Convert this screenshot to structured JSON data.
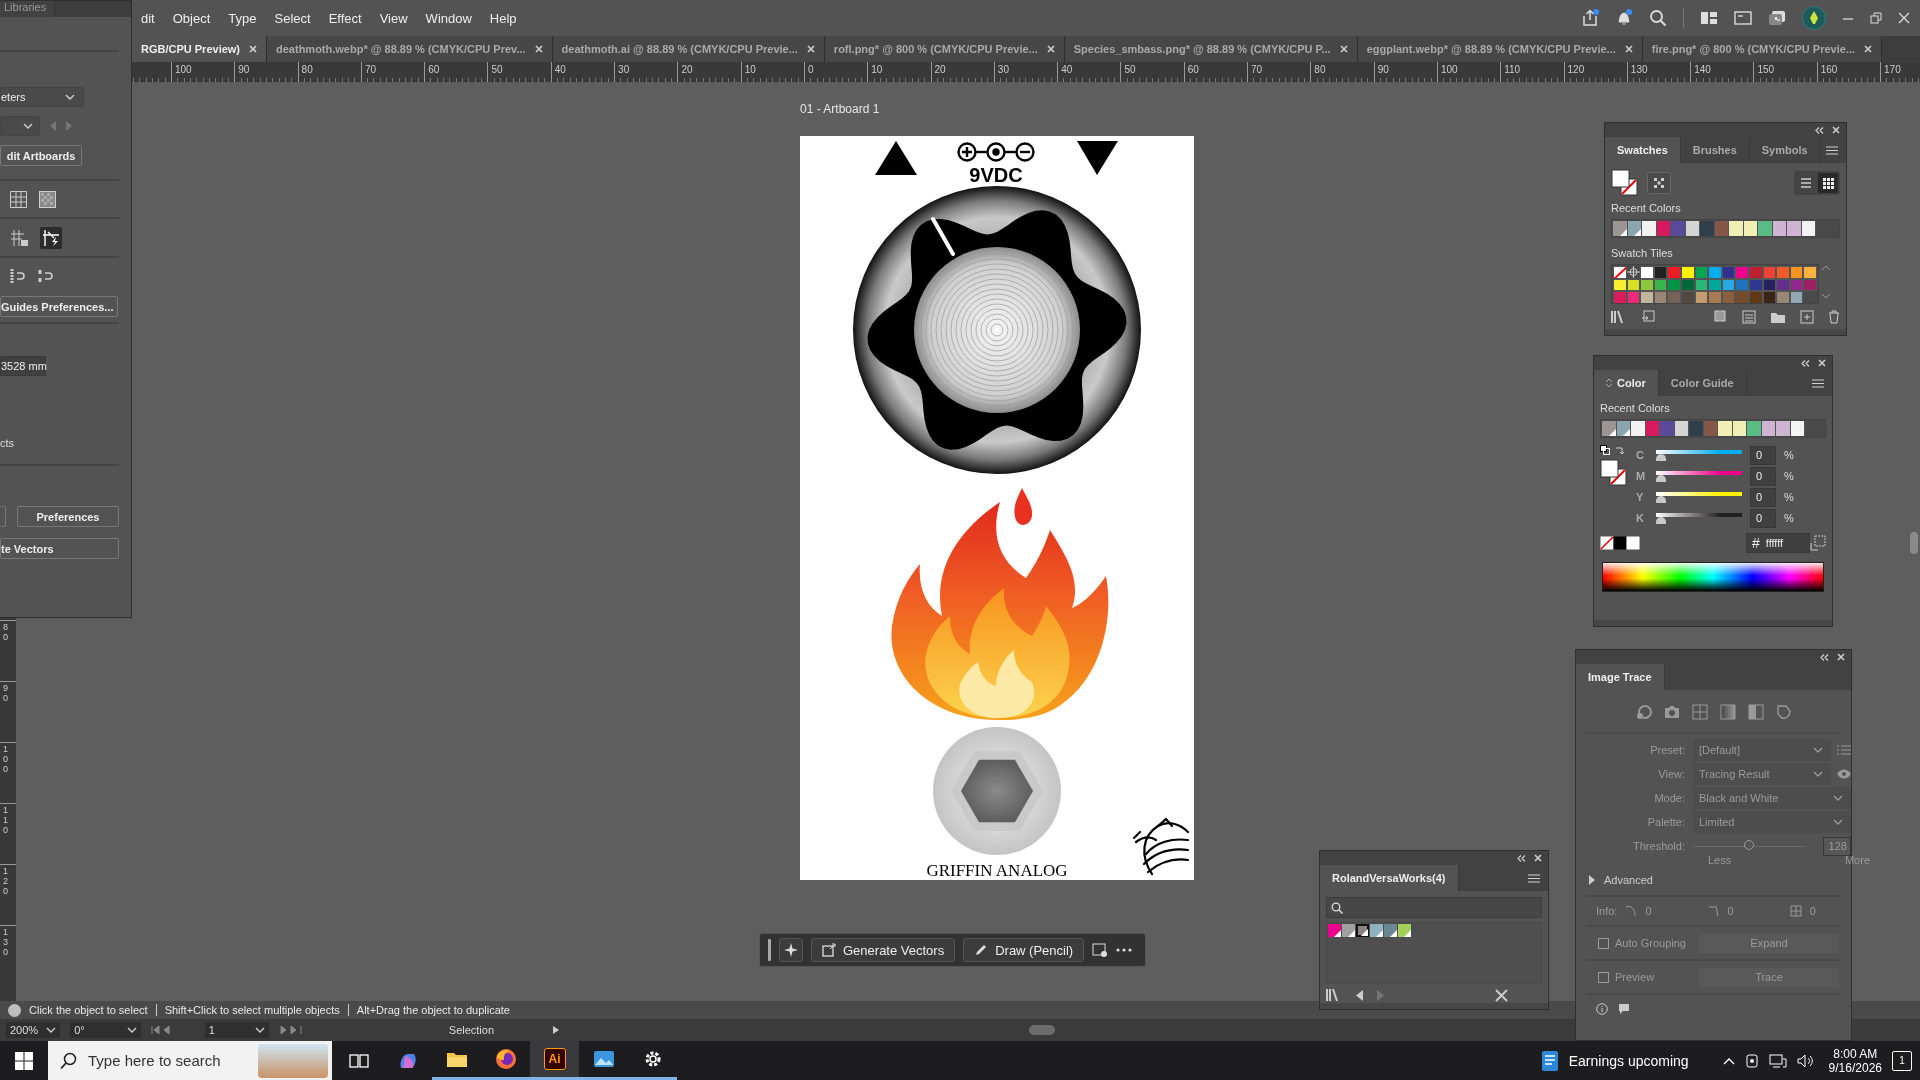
{
  "left_panel": {
    "tab": "Libraries",
    "units_dropdown": "eters",
    "edit_artboards_button": "dit Artboards",
    "guides_button": "Guides Preferences...",
    "nudge_field": "3528 mm",
    "label": "cts",
    "preferences_button": "Preferences",
    "vectors_button": "te Vectors"
  },
  "menu": [
    "dit",
    "Object",
    "Type",
    "Select",
    "Effect",
    "View",
    "Window",
    "Help"
  ],
  "doc_tabs": [
    {
      "label": "RGB/CPU Preview)",
      "selected": true
    },
    {
      "label": "deathmoth.webp* @ 88.89 % (CMYK/CPU Prev...",
      "selected": false
    },
    {
      "label": "deathmoth.ai @ 88.89 % (CMYK/CPU Previe...",
      "selected": false
    },
    {
      "label": "rofl.png* @ 800 % (CMYK/CPU Previe...",
      "selected": false
    },
    {
      "label": "Species_smbass.png* @ 88.89 % (CMYK/CPU P...",
      "selected": false
    },
    {
      "label": "eggplant.webp* @ 88.89 % (CMYK/CPU Previe...",
      "selected": false
    },
    {
      "label": "fire.png* @ 800 % (CMYK/CPU Previe...",
      "selected": false
    }
  ],
  "ruler": [
    "100",
    "90",
    "80",
    "70",
    "60",
    "50",
    "40",
    "30",
    "20",
    "10",
    "0",
    "10",
    "20",
    "30",
    "40",
    "50",
    "60",
    "70",
    "80",
    "90",
    "100",
    "110",
    "120",
    "130",
    "140",
    "150",
    "160",
    "170"
  ],
  "vertical_ruler": [
    "80",
    "90",
    "100",
    "110",
    "120",
    "130"
  ],
  "artboard": {
    "label": "01 - Artboard 1",
    "jack_label": "9VDC",
    "brand": "GRIFFIN ANALOG"
  },
  "swatches_panel": {
    "tabs": [
      {
        "label": "Swatches",
        "selected": true
      },
      {
        "label": "Brushes",
        "selected": false
      },
      {
        "label": "Symbols",
        "selected": false
      }
    ],
    "recent_label": "Recent Colors",
    "recent_colors": [
      {
        "color": "#9c9593",
        "global": true
      },
      {
        "color": "#8aa6b0",
        "global": true
      },
      {
        "color": "#f2f2f2",
        "global": false
      },
      {
        "color": "#d81b60",
        "global": false
      },
      {
        "color": "#5b4a9b",
        "global": false
      },
      {
        "color": "#d4d4d4",
        "global": false
      },
      {
        "color": "#2f3f4c",
        "global": false
      },
      {
        "color": "#85574b",
        "global": false
      },
      {
        "color": "#f0efb5",
        "global": false
      },
      {
        "color": "#f0efb5",
        "global": false
      },
      {
        "color": "#58bc84",
        "global": false
      },
      {
        "color": "#ceb3d3",
        "global": false
      },
      {
        "color": "#ceb3d3",
        "global": false
      },
      {
        "color": "#f3f3f3",
        "global": false
      }
    ],
    "tiles_label": "Swatch Tiles",
    "tiles": [
      {
        "kind": "none"
      },
      {
        "kind": "registration"
      },
      {
        "kind": "color",
        "color": "#ffffff"
      },
      {
        "kind": "color",
        "color": "#231f20"
      },
      {
        "kind": "color",
        "color": "#ed1c24"
      },
      {
        "kind": "color",
        "color": "#fff200"
      },
      {
        "kind": "color",
        "color": "#00a651"
      },
      {
        "kind": "color",
        "color": "#00aeef"
      },
      {
        "kind": "color",
        "color": "#2e3192"
      },
      {
        "kind": "color",
        "color": "#ec008c"
      },
      {
        "kind": "color",
        "color": "#be1e2d"
      },
      {
        "kind": "color",
        "color": "#ef4136"
      },
      {
        "kind": "color",
        "color": "#f15a29"
      },
      {
        "kind": "color",
        "color": "#f7941d"
      },
      {
        "kind": "color",
        "color": "#fbb040"
      },
      {
        "kind": "color",
        "color": "#f9ed32"
      },
      {
        "kind": "color",
        "color": "#d7df23"
      },
      {
        "kind": "color",
        "color": "#8dc63f"
      },
      {
        "kind": "color",
        "color": "#39b54a"
      },
      {
        "kind": "color",
        "color": "#009444"
      },
      {
        "kind": "color",
        "color": "#006838"
      },
      {
        "kind": "color",
        "color": "#2bb673"
      },
      {
        "kind": "color",
        "color": "#00a79d"
      },
      {
        "kind": "color",
        "color": "#27aae1"
      },
      {
        "kind": "color",
        "color": "#1c75bc"
      },
      {
        "kind": "color",
        "color": "#2b3990"
      },
      {
        "kind": "color",
        "color": "#262262"
      },
      {
        "kind": "color",
        "color": "#662d91"
      },
      {
        "kind": "color",
        "color": "#92278f"
      },
      {
        "kind": "color",
        "color": "#9e1f63"
      },
      {
        "kind": "color",
        "color": "#da1c5c"
      },
      {
        "kind": "color",
        "color": "#ee2a7b"
      },
      {
        "kind": "color",
        "color": "#c2b59b"
      },
      {
        "kind": "color",
        "color": "#998675"
      },
      {
        "kind": "color",
        "color": "#736357"
      },
      {
        "kind": "color",
        "color": "#534741"
      },
      {
        "kind": "color",
        "color": "#c69c6d"
      },
      {
        "kind": "color",
        "color": "#a67c52"
      },
      {
        "kind": "color",
        "color": "#8b5e3c"
      },
      {
        "kind": "color",
        "color": "#754c29"
      },
      {
        "kind": "color",
        "color": "#603913"
      },
      {
        "kind": "color",
        "color": "#3c2415"
      },
      {
        "kind": "color",
        "color": "#998675"
      },
      {
        "kind": "color",
        "color": "#8fa8b2"
      }
    ]
  },
  "color_panel": {
    "tabs": [
      {
        "label": "Color",
        "selected": true
      },
      {
        "label": "Color Guide",
        "selected": false
      }
    ],
    "recent_label": "Recent Colors",
    "recent_colors": [
      {
        "color": "#9c9593",
        "global": true
      },
      {
        "color": "#8aa6b0",
        "global": true
      },
      {
        "color": "#f2f2f2",
        "global": false
      },
      {
        "color": "#d81b60",
        "global": false
      },
      {
        "color": "#5b4a9b",
        "global": false
      },
      {
        "color": "#d4d4d4",
        "global": false
      },
      {
        "color": "#2f3f4c",
        "global": false
      },
      {
        "color": "#85574b",
        "global": false
      },
      {
        "color": "#f0efb5",
        "global": false
      },
      {
        "color": "#f0efb5",
        "global": false
      },
      {
        "color": "#58bc84",
        "global": false
      },
      {
        "color": "#ceb3d3",
        "global": false
      },
      {
        "color": "#ceb3d3",
        "global": false
      },
      {
        "color": "#f3f3f3",
        "global": false
      }
    ],
    "sliders": [
      {
        "label": "C",
        "level": 0,
        "value": "0",
        "unit": "%",
        "color": "#00aeef"
      },
      {
        "label": "M",
        "level": 0,
        "value": "0",
        "unit": "%",
        "color": "#ec008c"
      },
      {
        "label": "Y",
        "level": 0,
        "value": "0",
        "unit": "%",
        "color": "#fff200"
      },
      {
        "label": "K",
        "level": 0,
        "value": "0",
        "unit": "%",
        "color": "#231f20"
      }
    ],
    "hex_prefix": "#",
    "hex": "ffffff"
  },
  "image_trace": {
    "title": "Image Trace",
    "disabled": true,
    "fields": [
      {
        "label": "Preset:",
        "value": "[Default]"
      },
      {
        "label": "View:",
        "value": "Tracing Result"
      },
      {
        "label": "Mode:",
        "value": "Black and White"
      },
      {
        "label": "Palette:",
        "value": "Limited"
      }
    ],
    "threshold": {
      "label": "Threshold:",
      "level": 0.5,
      "value": "128",
      "less": "Less",
      "more": "More"
    },
    "advanced": {
      "label": "Advanced",
      "expanded": false
    },
    "info": {
      "label": "Info:",
      "paths": "0",
      "anchors": "0",
      "colors": "0"
    },
    "auto_grouping": {
      "label": "Auto Grouping",
      "checked": false
    },
    "expand_button": "Expand",
    "preview": {
      "label": "Preview",
      "checked": false
    },
    "trace_button": "Trace"
  },
  "roland_panel": {
    "title": "RolandVersaWorks(4)",
    "swatches": [
      {
        "color": "#ec008c",
        "selected": false
      },
      {
        "color": "#a0a0a0",
        "selected": false
      },
      {
        "color": "#8c8480",
        "selected": true
      },
      {
        "color": "#8fb2c0",
        "selected": false
      },
      {
        "color": "#6c8794",
        "selected": false
      },
      {
        "color": "#a2d05a",
        "selected": false
      }
    ]
  },
  "toolbar": {
    "generate_button": "Generate Vectors",
    "draw_button": "Draw (Pencil)"
  },
  "status_bar": [
    "Click the object to select",
    "Shift+Click to select multiple objects",
    "Alt+Drag the object to duplicate"
  ],
  "info_bar": {
    "zoom": "200%",
    "rotation": "0°",
    "artboard": "1",
    "tool": "Selection"
  },
  "taskbar": {
    "search_placeholder": "Type here to search",
    "apps": [
      {
        "kind": "task-view",
        "running": false,
        "selected": false
      },
      {
        "kind": "copilot",
        "running": false,
        "selected": false
      },
      {
        "kind": "folder",
        "running": true,
        "selected": false
      },
      {
        "kind": "firefox",
        "running": true,
        "selected": false
      },
      {
        "kind": "illustrator",
        "label": "Ai",
        "running": true,
        "selected": true
      },
      {
        "kind": "photos",
        "running": true,
        "selected": false
      },
      {
        "kind": "settings",
        "running": true,
        "selected": false
      }
    ],
    "news": "Earnings upcoming",
    "time": "8:00 AM",
    "date": "9/16/2026",
    "notifications": "1"
  }
}
